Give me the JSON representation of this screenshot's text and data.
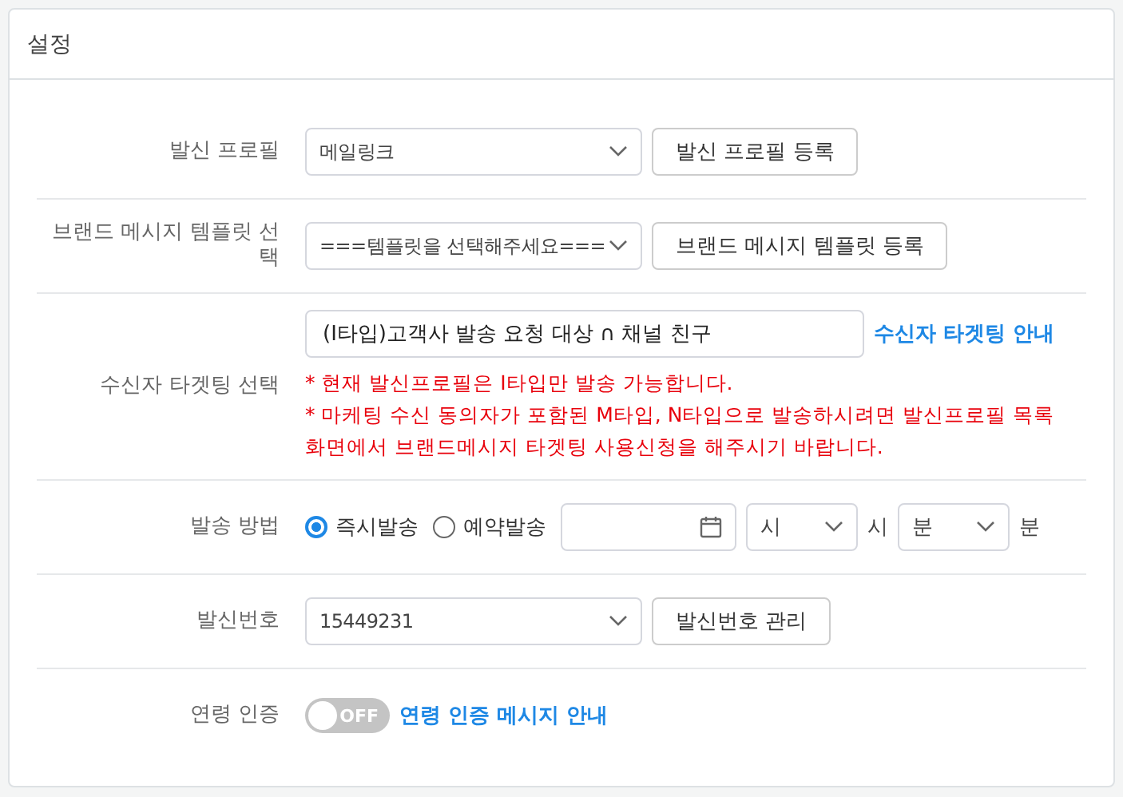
{
  "panel": {
    "title": "설정"
  },
  "rows": [
    {
      "kind": "select_button",
      "label": "발신 프로필",
      "select": "메일링크",
      "button": "발신 프로필 등록"
    },
    {
      "kind": "select_button",
      "label": "브랜드 메시지 템플릿 선택",
      "select": "===템플릿을 선택해주세요===",
      "button": "브랜드 메시지 템플릿 등록"
    },
    {
      "kind": "targeting",
      "label": "수신자 타겟팅 선택",
      "value": "(I타입)고객사 발송 요청 대상 ∩ 채널 친구",
      "link": "수신자 타겟팅 안내",
      "notes": [
        "* 현재 발신프로필은 I타입만 발송 가능합니다.",
        "* 마케팅 수신 동의자가 포함된 M타입, N타입으로 발송하시려면 발신프로필 목록 화면에서 브랜드메시지 타겟팅 사용신청을 해주시기 바랍니다."
      ]
    },
    {
      "kind": "send_method",
      "label": "발송 방법",
      "options": [
        {
          "label": "즉시발송",
          "selected": true
        },
        {
          "label": "예약발송",
          "selected": false
        }
      ],
      "hour": "시",
      "hour_unit": "시",
      "minute": "분",
      "minute_unit": "분"
    },
    {
      "kind": "select_button",
      "label": "발신번호",
      "select": "15449231",
      "button": "발신번호 관리"
    },
    {
      "kind": "toggle",
      "label": "연령 인증",
      "on": false,
      "toggle_text": "OFF",
      "link": "연령 인증 메시지 안내"
    }
  ]
}
